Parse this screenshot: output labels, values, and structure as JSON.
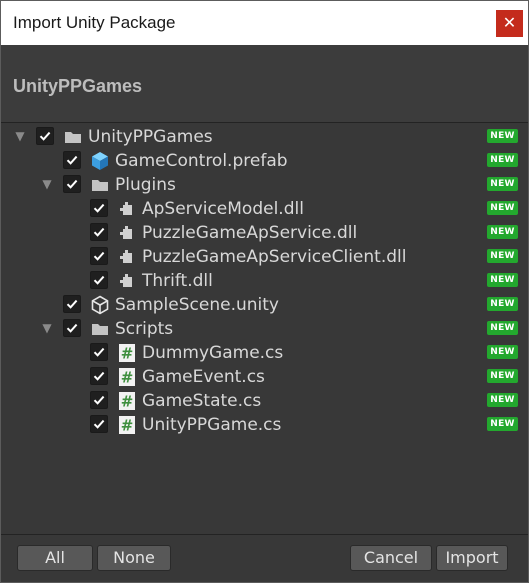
{
  "window": {
    "title": "Import Unity Package",
    "close_glyph": "✕"
  },
  "header": {
    "title": "UnityPPGames"
  },
  "tree": [
    {
      "label": "UnityPPGames",
      "depth": 0,
      "fold": "down",
      "icon": "folder-icon",
      "checked": true,
      "badge": "NEW"
    },
    {
      "label": "GameControl.prefab",
      "depth": 1,
      "fold": "none",
      "icon": "prefab-cube-icon",
      "checked": true,
      "badge": "NEW"
    },
    {
      "label": "Plugins",
      "depth": 1,
      "fold": "down",
      "icon": "folder-icon",
      "checked": true,
      "badge": "NEW"
    },
    {
      "label": "ApServiceModel.dll",
      "depth": 2,
      "fold": "none",
      "icon": "dll-plugin-icon",
      "checked": true,
      "badge": "NEW"
    },
    {
      "label": "PuzzleGameApService.dll",
      "depth": 2,
      "fold": "none",
      "icon": "dll-plugin-icon",
      "checked": true,
      "badge": "NEW"
    },
    {
      "label": "PuzzleGameApServiceClient.dll",
      "depth": 2,
      "fold": "none",
      "icon": "dll-plugin-icon",
      "checked": true,
      "badge": "NEW"
    },
    {
      "label": "Thrift.dll",
      "depth": 2,
      "fold": "none",
      "icon": "dll-plugin-icon",
      "checked": true,
      "badge": "NEW"
    },
    {
      "label": "SampleScene.unity",
      "depth": 1,
      "fold": "none",
      "icon": "unity-scene-icon",
      "checked": true,
      "badge": "NEW"
    },
    {
      "label": "Scripts",
      "depth": 1,
      "fold": "down",
      "icon": "folder-icon",
      "checked": true,
      "badge": "NEW"
    },
    {
      "label": "DummyGame.cs",
      "depth": 2,
      "fold": "none",
      "icon": "csharp-script-icon",
      "checked": true,
      "badge": "NEW"
    },
    {
      "label": "GameEvent.cs",
      "depth": 2,
      "fold": "none",
      "icon": "csharp-script-icon",
      "checked": true,
      "badge": "NEW"
    },
    {
      "label": "GameState.cs",
      "depth": 2,
      "fold": "none",
      "icon": "csharp-script-icon",
      "checked": true,
      "badge": "NEW"
    },
    {
      "label": "UnityPPGame.cs",
      "depth": 2,
      "fold": "none",
      "icon": "csharp-script-icon",
      "checked": true,
      "badge": "NEW"
    }
  ],
  "footer": {
    "all_label": "All",
    "none_label": "None",
    "cancel_label": "Cancel",
    "import_label": "Import"
  },
  "colors": {
    "badge_green": "#23a82e",
    "close_red": "#c42b1c",
    "panel": "#383838"
  }
}
